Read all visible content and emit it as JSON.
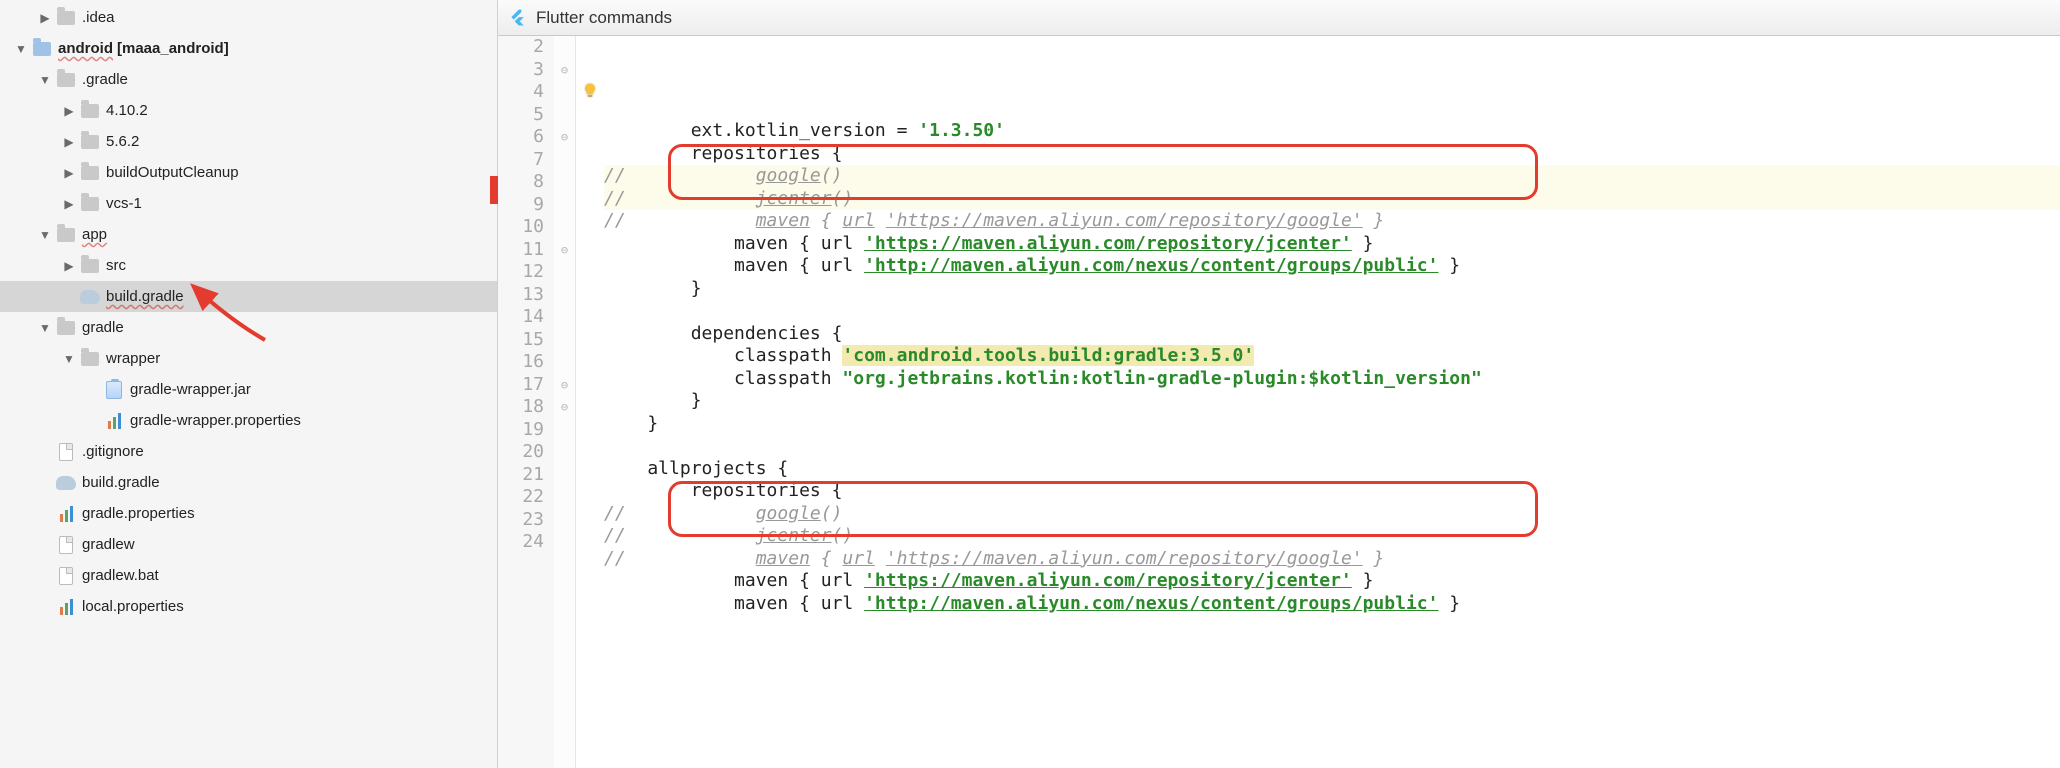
{
  "banner": {
    "title": "Flutter commands"
  },
  "tree": [
    {
      "indent": 38,
      "chev": "right",
      "icon": "folder",
      "label": ".idea"
    },
    {
      "indent": 14,
      "chev": "down",
      "icon": "folder-blue",
      "label": "android",
      "wavy": true,
      "bold": true,
      "suffix": "[maaa_android]"
    },
    {
      "indent": 38,
      "chev": "down",
      "icon": "folder",
      "label": ".gradle"
    },
    {
      "indent": 62,
      "chev": "right",
      "icon": "folder",
      "label": "4.10.2"
    },
    {
      "indent": 62,
      "chev": "right",
      "icon": "folder",
      "label": "5.6.2"
    },
    {
      "indent": 62,
      "chev": "right",
      "icon": "folder",
      "label": "buildOutputCleanup"
    },
    {
      "indent": 62,
      "chev": "right",
      "icon": "folder",
      "label": "vcs-1"
    },
    {
      "indent": 38,
      "chev": "down",
      "icon": "folder",
      "label": "app",
      "wavy": true
    },
    {
      "indent": 62,
      "chev": "right",
      "icon": "folder",
      "label": "src"
    },
    {
      "indent": 62,
      "chev": "blank",
      "icon": "gradle",
      "label": "build.gradle",
      "wavy": true,
      "selected": true
    },
    {
      "indent": 38,
      "chev": "down",
      "icon": "folder",
      "label": "gradle"
    },
    {
      "indent": 62,
      "chev": "down",
      "icon": "folder",
      "label": "wrapper"
    },
    {
      "indent": 86,
      "chev": "blank",
      "icon": "jar",
      "label": "gradle-wrapper.jar"
    },
    {
      "indent": 86,
      "chev": "blank",
      "icon": "bars",
      "label": "gradle-wrapper.properties"
    },
    {
      "indent": 38,
      "chev": "blank",
      "icon": "file",
      "label": ".gitignore"
    },
    {
      "indent": 38,
      "chev": "blank",
      "icon": "gradle",
      "label": "build.gradle"
    },
    {
      "indent": 38,
      "chev": "blank",
      "icon": "bars",
      "label": "gradle.properties"
    },
    {
      "indent": 38,
      "chev": "blank",
      "icon": "file",
      "label": "gradlew"
    },
    {
      "indent": 38,
      "chev": "blank",
      "icon": "file",
      "label": "gradlew.bat"
    },
    {
      "indent": 38,
      "chev": "blank",
      "icon": "bars",
      "label": "local.properties"
    }
  ],
  "lines": [
    {
      "n": 2,
      "fold": "",
      "ann": "",
      "t": "plain",
      "code": "        ext.kotlin_version = '1.3.50'"
    },
    {
      "n": 3,
      "fold": "⊖",
      "ann": "",
      "t": "plain",
      "code": "        repositories {"
    },
    {
      "n": 4,
      "fold": "",
      "ann": "bulb",
      "t": "comment",
      "code": "//            google()",
      "hl": true
    },
    {
      "n": 5,
      "fold": "",
      "ann": "",
      "t": "comment",
      "code": "//            jcenter()",
      "hl": true
    },
    {
      "n": 6,
      "fold": "⊖",
      "ann": "",
      "t": "comment",
      "code": "//            maven { url 'https://maven.aliyun.com/repository/google' }"
    },
    {
      "n": 7,
      "fold": "",
      "ann": "",
      "t": "maven",
      "code": "            maven { url 'https://maven.aliyun.com/repository/jcenter' }"
    },
    {
      "n": 8,
      "fold": "",
      "ann": "",
      "t": "maven",
      "code": "            maven { url 'http://maven.aliyun.com/nexus/content/groups/public' }"
    },
    {
      "n": 9,
      "fold": "",
      "ann": "",
      "t": "plain",
      "code": "        }"
    },
    {
      "n": 10,
      "fold": "",
      "ann": "",
      "t": "plain",
      "code": ""
    },
    {
      "n": 11,
      "fold": "⊖",
      "ann": "",
      "t": "plain",
      "code": "        dependencies {"
    },
    {
      "n": 12,
      "fold": "",
      "ann": "",
      "t": "dep1",
      "code": "            classpath 'com.android.tools.build:gradle:3.5.0'"
    },
    {
      "n": 13,
      "fold": "",
      "ann": "",
      "t": "dep2",
      "code": "            classpath \"org.jetbrains.kotlin:kotlin-gradle-plugin:$kotlin_version\""
    },
    {
      "n": 14,
      "fold": "",
      "ann": "",
      "t": "plain",
      "code": "        }"
    },
    {
      "n": 15,
      "fold": "",
      "ann": "",
      "t": "plain",
      "code": "    }"
    },
    {
      "n": 16,
      "fold": "",
      "ann": "",
      "t": "plain",
      "code": ""
    },
    {
      "n": 17,
      "fold": "⊖",
      "ann": "",
      "t": "plain",
      "code": "    allprojects {"
    },
    {
      "n": 18,
      "fold": "⊖",
      "ann": "",
      "t": "plain",
      "code": "        repositories {"
    },
    {
      "n": 19,
      "fold": "",
      "ann": "",
      "t": "comment",
      "code": "//            google()"
    },
    {
      "n": 20,
      "fold": "",
      "ann": "",
      "t": "comment",
      "code": "//            jcenter()"
    },
    {
      "n": 21,
      "fold": "",
      "ann": "",
      "t": "comment",
      "code": "//            maven { url 'https://maven.aliyun.com/repository/google' }"
    },
    {
      "n": 22,
      "fold": "",
      "ann": "",
      "t": "maven",
      "code": "            maven { url 'https://maven.aliyun.com/repository/jcenter' }"
    },
    {
      "n": 23,
      "fold": "",
      "ann": "",
      "t": "maven",
      "code": "            maven { url 'http://maven.aliyun.com/nexus/content/groups/public' }"
    },
    {
      "n": 24,
      "fold": "",
      "ann": "",
      "t": "plain",
      "code": ""
    }
  ]
}
